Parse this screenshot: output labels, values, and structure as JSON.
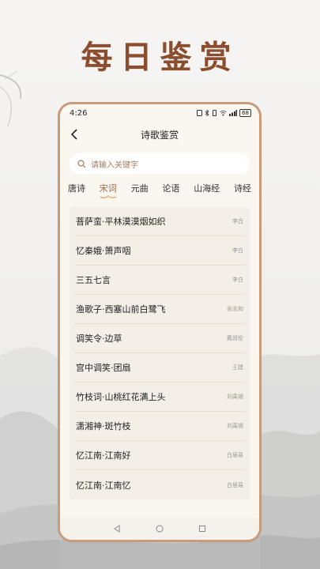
{
  "hero": {
    "title": "每日鉴赏"
  },
  "status": {
    "time": "4:26",
    "battery": "68"
  },
  "nav": {
    "title": "诗歌鉴赏"
  },
  "search": {
    "placeholder": "请输入关键字"
  },
  "tabs": [
    {
      "label": "唐诗",
      "active": false
    },
    {
      "label": "宋词",
      "active": true
    },
    {
      "label": "元曲",
      "active": false
    },
    {
      "label": "论语",
      "active": false
    },
    {
      "label": "山海经",
      "active": false
    },
    {
      "label": "诗经",
      "active": false
    }
  ],
  "poems": [
    {
      "title": "菩萨蛮·平林漠漠烟如织",
      "author": "李白"
    },
    {
      "title": "忆秦娥·箫声咽",
      "author": "李白"
    },
    {
      "title": "三五七言",
      "author": "李白"
    },
    {
      "title": "渔歌子·西塞山前白鹭飞",
      "author": "张志和"
    },
    {
      "title": "调笑令·边草",
      "author": "戴叔伦"
    },
    {
      "title": "宫中调笑·团扇",
      "author": "王建"
    },
    {
      "title": "竹枝词·山桃红花满上头",
      "author": "刘禹锡"
    },
    {
      "title": "潇湘神·斑竹枝",
      "author": "刘禹锡"
    },
    {
      "title": "忆江南·江南好",
      "author": "白居易"
    },
    {
      "title": "忆江南·江南忆",
      "author": "白居易"
    }
  ],
  "colors": {
    "accent": "#a06a48",
    "hero": "#8a4e2e",
    "frame": "#c89b7a"
  }
}
